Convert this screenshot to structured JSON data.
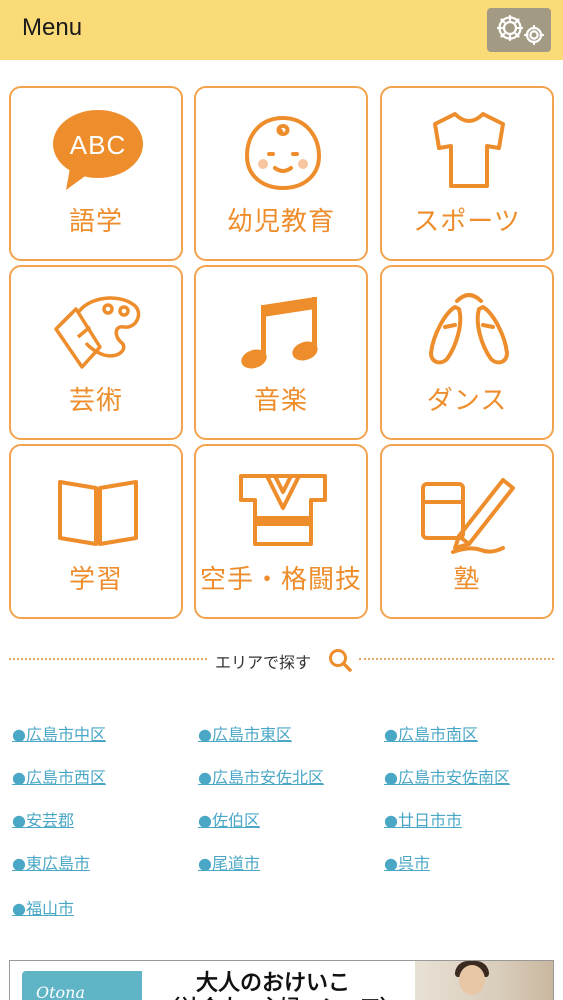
{
  "header": {
    "title": "Menu",
    "settings_icon": "gear-icon"
  },
  "categories": [
    {
      "label": "語学",
      "icon": "abc-speech-bubble-icon"
    },
    {
      "label": "幼児教育",
      "icon": "baby-face-icon"
    },
    {
      "label": "スポーツ",
      "icon": "t-shirt-icon"
    },
    {
      "label": "芸術",
      "icon": "paint-palette-icon"
    },
    {
      "label": "音楽",
      "icon": "music-note-icon"
    },
    {
      "label": "ダンス",
      "icon": "ballet-shoes-icon"
    },
    {
      "label": "学習",
      "icon": "open-book-icon"
    },
    {
      "label": "空手・格闘技",
      "icon": "karate-gi-icon"
    },
    {
      "label": "塾",
      "icon": "pencil-eraser-icon"
    }
  ],
  "category_icon_text": "ABC",
  "area_search": {
    "label": "エリアで探す",
    "icon": "search-icon"
  },
  "areas": [
    "●広島市中区",
    "●広島市東区",
    "●広島市南区",
    "●広島市西区",
    "●広島市安佐北区",
    "●広島市安佐南区",
    "●安芸郡",
    "●佐伯区",
    "●廿日市市",
    "●東広島市",
    "●尾道市",
    "●呉市",
    "●福山市"
  ],
  "banner": {
    "flag_text": "Otona",
    "title": "大人のおけいこ",
    "subtitle": "（社会人・主婦・シニア）"
  },
  "colors": {
    "header_bg": "#fbdb78",
    "accent_orange": "#ee8d2c",
    "tile_border": "#f3a34d",
    "link_blue": "#4aa7c6",
    "settings_bg": "#a39a84"
  }
}
